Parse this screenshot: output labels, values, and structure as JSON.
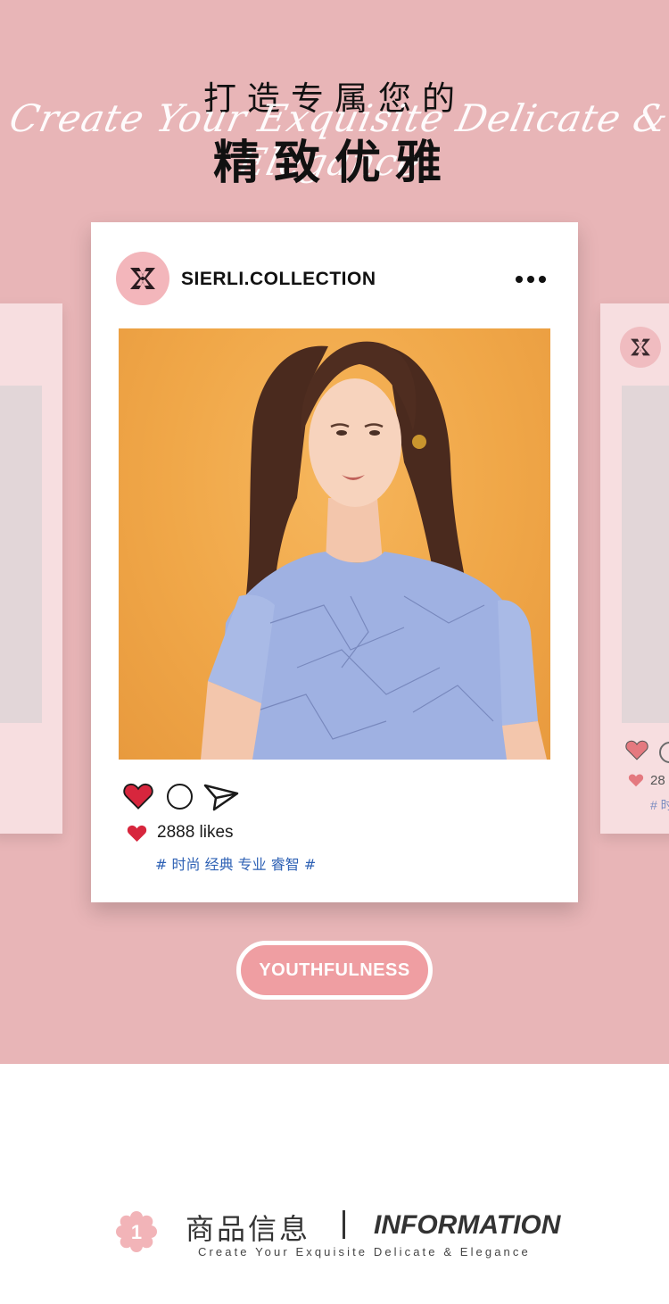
{
  "hero": {
    "title_line1": "打造专属您的",
    "title_script": "Create Your Exquisite Delicate & Elegance",
    "title_line2": "精致优雅"
  },
  "post": {
    "account_name": "SIERLI.COLLECTION",
    "likes": "2888 likes",
    "hashtags": "# 时尚 经典 专业 睿智 #",
    "icons": [
      "brand-logo-icon",
      "more-dots-icon",
      "heart-icon",
      "comment-icon",
      "share-icon"
    ]
  },
  "side_cards": {
    "likes_partial": "28",
    "tags_partial": "# 时"
  },
  "tag_pill": {
    "label": "YOUTHFULNESS"
  },
  "info": {
    "badge_number": "1",
    "title_cn": "商品信息",
    "title_en": "INFORMATION",
    "subtitle": "Create Your Exquisite Delicate & Elegance"
  },
  "colors": {
    "hero_background": "#e8b5b7",
    "side_card": "#f7dee0",
    "heart_red": "#d7263d",
    "hashtag_blue": "#2f62b5",
    "pill_pink": "#ef9ea2",
    "badge_pink": "#f2b4b8",
    "photo_orange": "#f0a748",
    "dress_blue": "#9fb1e2"
  }
}
